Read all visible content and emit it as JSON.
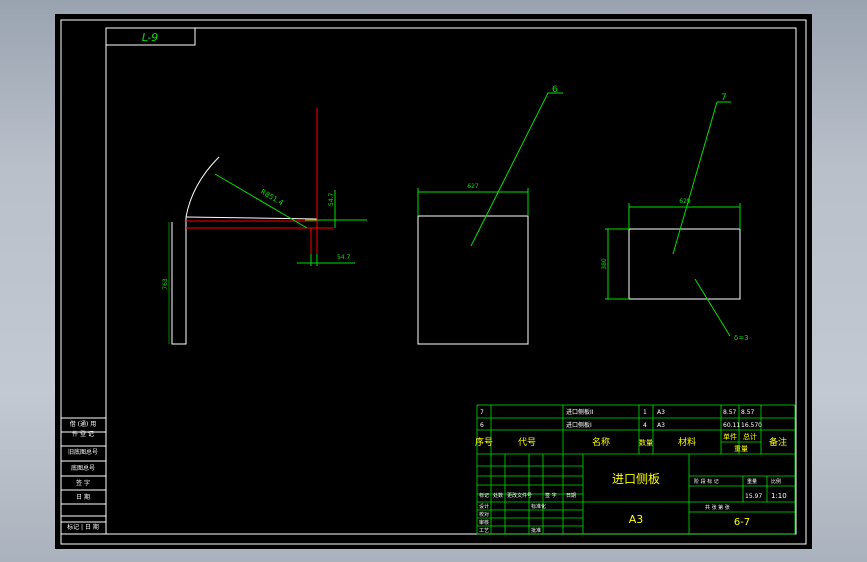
{
  "drawing": {
    "corner_label": "L-9",
    "dims": {
      "arc_radius": "R851.4",
      "height_left": "763",
      "small_vertical": "54.7",
      "small_horizontal": "54.7",
      "part6_width": "627",
      "part7_width": "629",
      "part7_height": "380"
    },
    "balloons": {
      "p6": "6",
      "p7": "7"
    },
    "thickness_note": "δ=3"
  },
  "side_table": {
    "rows": [
      "借 (通) 用",
      "件 登 记",
      "旧底图总号",
      "底图总号",
      "签  字",
      "日  期",
      "标记 | 日 期"
    ]
  },
  "title_block": {
    "rows": [
      {
        "seq": "7",
        "name": "进口侧板II",
        "qty": "1",
        "material": "A3",
        "single": "8.57",
        "total": "8.57"
      },
      {
        "seq": "6",
        "name": "进口侧板I",
        "qty": "4",
        "material": "A3",
        "single": "60.11",
        "total": "16.570"
      }
    ],
    "headers": {
      "seq": "序号",
      "code": "代号",
      "name": "名称",
      "qty": "数量",
      "material": "材料",
      "single": "单件",
      "total": "总计",
      "weight": "重量",
      "remark": "备注"
    },
    "part_title": "进口侧板",
    "material_main": "A3",
    "drawing_no": "6-7",
    "scale_label": "比例",
    "weight_label": "重量",
    "weight_val": "15.97",
    "scale_val": "1:10",
    "sheet_labels": "共   张   第   张",
    "stage_label": "阶 段 标 记",
    "sign_rows": [
      "标记",
      "处数",
      "更改文件号",
      "签 字",
      "日期"
    ],
    "role_rows": [
      "设计",
      "校对",
      "审核",
      "工艺",
      "标准化",
      "批准"
    ]
  },
  "colors": {
    "frame": "#ffffff",
    "dims": "#00e000",
    "cut": "#ff0000",
    "title": "#ffff00"
  }
}
